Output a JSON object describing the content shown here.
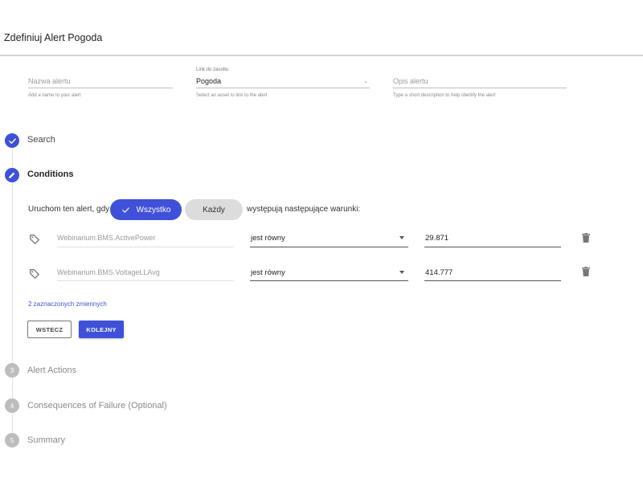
{
  "header": {
    "title": "Zdefiniuj Alert Pogoda"
  },
  "form": {
    "alert_name": {
      "placeholder": "Nazwa alertu",
      "helper": "Add a name to your alert"
    },
    "asset_link": {
      "label": "Link do zasobu",
      "value": "Pogoda",
      "helper": "Select an asset to link to the alert"
    },
    "description": {
      "placeholder": "Opis alertu",
      "helper": "Type a short description to help identify the alert"
    }
  },
  "steps": [
    {
      "number": "1",
      "label": "Search",
      "state": "done"
    },
    {
      "number": "2",
      "label": "Conditions",
      "state": "active"
    },
    {
      "number": "3",
      "label": "Alert Actions",
      "state": "pending"
    },
    {
      "number": "4",
      "label": "Consequences of Failure (Optional)",
      "state": "pending"
    },
    {
      "number": "5",
      "label": "Summary",
      "state": "pending"
    }
  ],
  "conditions": {
    "prefix": "Uruchom ten alert, gdy",
    "chip_all": "Wszystko",
    "chip_any": "Każdy",
    "suffix": "występują następujące warunki:",
    "rows": [
      {
        "variable": "Webinarium.BMS.ActivePower",
        "operator": "jest równy",
        "value": "29.871"
      },
      {
        "variable": "Webinarium.BMS.VoltageLLAvg",
        "operator": "jest równy",
        "value": "414.777"
      }
    ],
    "selected_link": "2 zaznaczonych zmiennych",
    "back_label": "WSTECZ",
    "next_label": "KOLEJNY"
  },
  "colors": {
    "accent": "#3f51d8",
    "chip_unselected": "#dcdcdc",
    "step_pending": "#bdbdbd"
  }
}
